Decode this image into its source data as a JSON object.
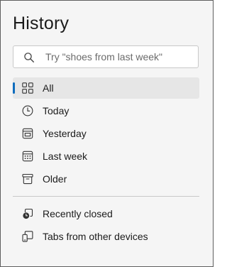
{
  "panel": {
    "title": "History"
  },
  "search": {
    "placeholder": "Try \"shoes from last week\"",
    "value": ""
  },
  "nav": {
    "items": [
      {
        "label": "All",
        "icon": "grid-icon",
        "selected": true
      },
      {
        "label": "Today",
        "icon": "clock-icon",
        "selected": false
      },
      {
        "label": "Yesterday",
        "icon": "calendar-day-icon",
        "selected": false
      },
      {
        "label": "Last week",
        "icon": "calendar-week-icon",
        "selected": false
      },
      {
        "label": "Older",
        "icon": "archive-icon",
        "selected": false
      }
    ],
    "extra_items": [
      {
        "label": "Recently closed",
        "icon": "recently-closed-icon"
      },
      {
        "label": "Tabs from other devices",
        "icon": "devices-icon"
      }
    ]
  },
  "colors": {
    "accent": "#0f6cbd",
    "panel_background": "#f5f5f5",
    "selected_background": "#e6e6e6"
  }
}
